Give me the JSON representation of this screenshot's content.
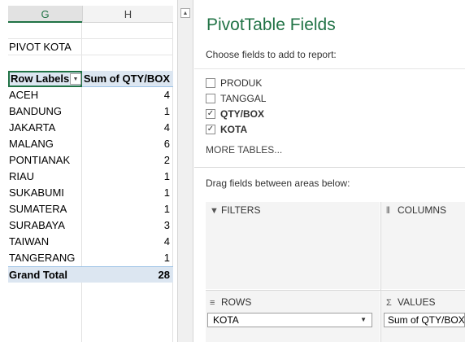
{
  "sheet": {
    "columns": [
      "G",
      "H"
    ],
    "pivot_title": "PIVOT KOTA",
    "header": {
      "row_labels": "Row Labels",
      "value_header": "Sum of QTY/BOX"
    },
    "rows": [
      {
        "label": "ACEH",
        "value": "4"
      },
      {
        "label": "BANDUNG",
        "value": "1"
      },
      {
        "label": "JAKARTA",
        "value": "4"
      },
      {
        "label": "MALANG",
        "value": "6"
      },
      {
        "label": "PONTIANAK",
        "value": "2"
      },
      {
        "label": "RIAU",
        "value": "1"
      },
      {
        "label": "SUKABUMI",
        "value": "1"
      },
      {
        "label": "SUMATERA",
        "value": "1"
      },
      {
        "label": "SURABAYA",
        "value": "3"
      },
      {
        "label": "TAIWAN",
        "value": "4"
      },
      {
        "label": "TANGERANG",
        "value": "1"
      }
    ],
    "grand_total": {
      "label": "Grand Total",
      "value": "28"
    }
  },
  "pane": {
    "title": "PivotTable Fields",
    "subtitle": "Choose fields to add to report:",
    "fields": [
      {
        "name": "PRODUK",
        "checked": false
      },
      {
        "name": "TANGGAL",
        "checked": false
      },
      {
        "name": "QTY/BOX",
        "checked": true
      },
      {
        "name": "KOTA",
        "checked": true
      }
    ],
    "more_tables": "MORE TABLES...",
    "drag_hint": "Drag fields between areas below:",
    "areas": {
      "filters": "FILTERS",
      "columns": "COLUMNS",
      "rows": "ROWS",
      "values": "VALUES"
    },
    "rows_field": "KOTA",
    "values_field": "Sum of QTY/BOX"
  },
  "icons": {
    "filter": "filter-funnel-icon",
    "columns": "columns-icon",
    "rows": "rows-icon",
    "values": "sigma-icon",
    "dropdown": "chevron-down-icon",
    "scroll_up": "scroll-up-arrow-icon"
  },
  "colors": {
    "accent": "#217346",
    "pivot_header_bg": "#dce6f1",
    "area_bg": "#f4f4f4"
  }
}
